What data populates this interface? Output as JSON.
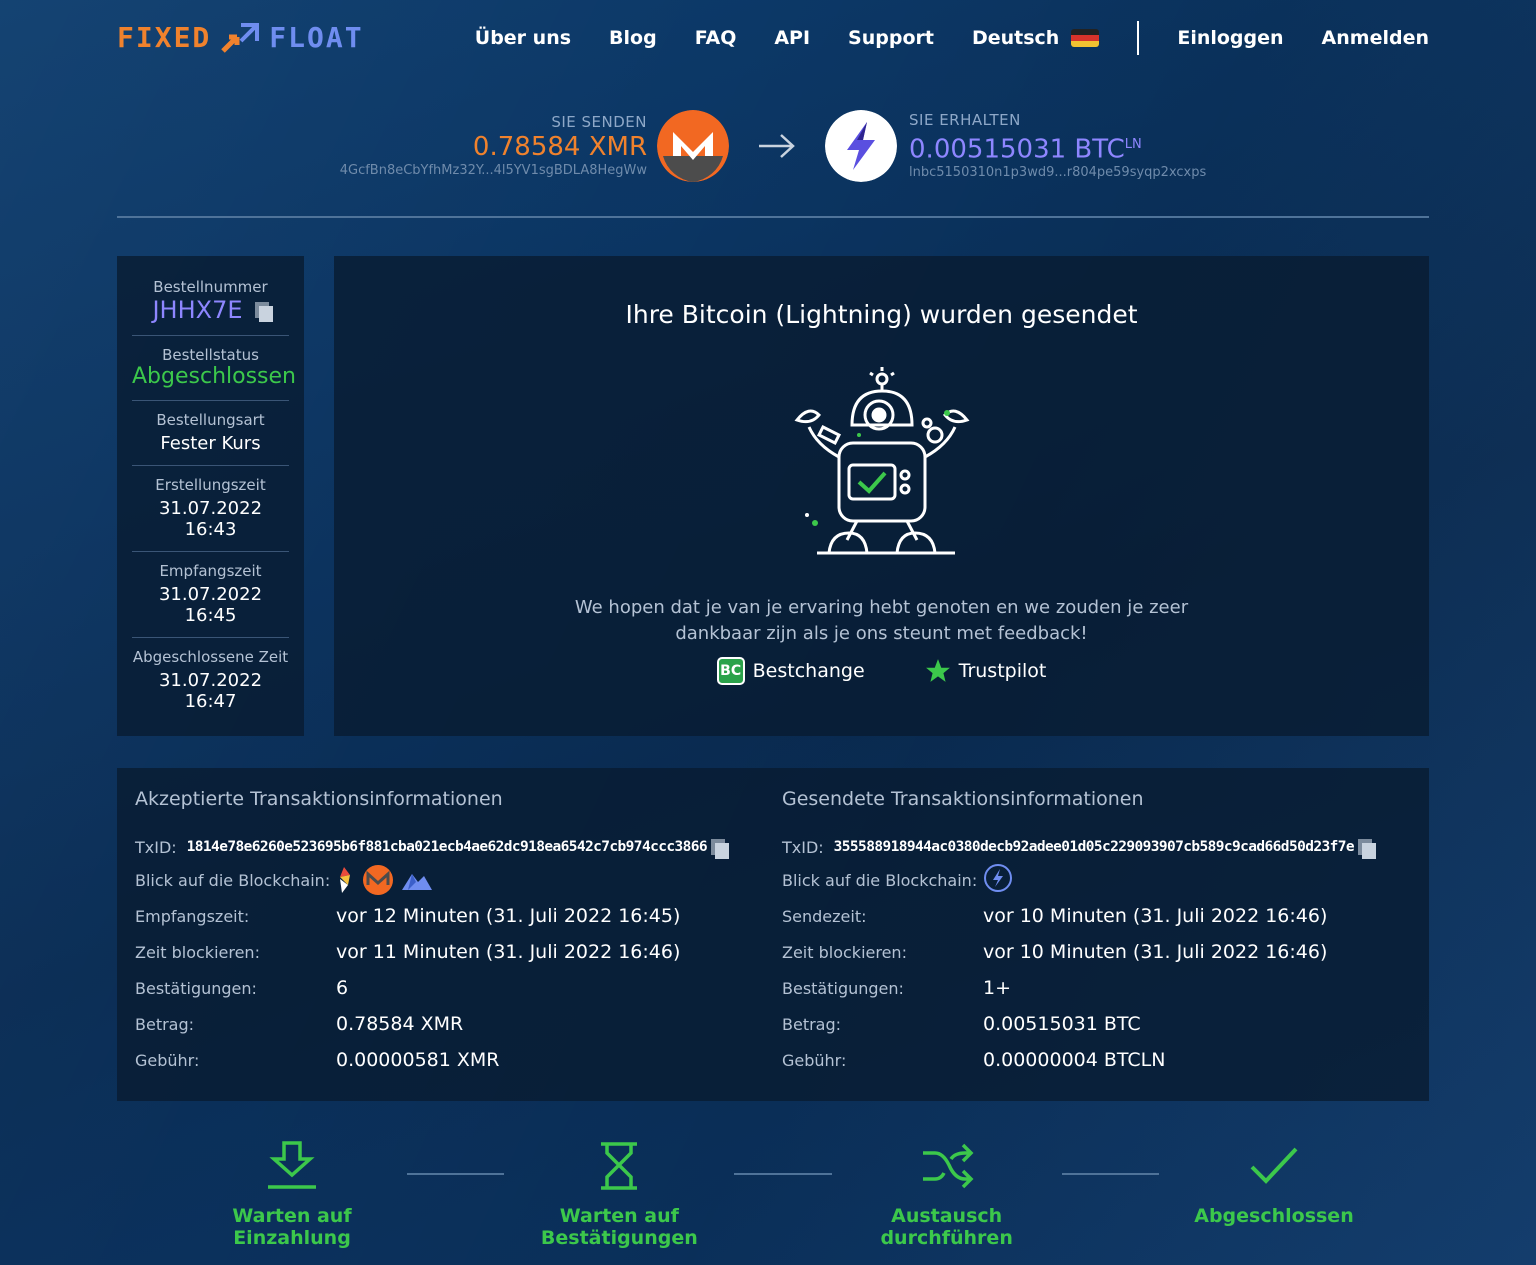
{
  "brand": {
    "part1": "FIXED",
    "part2": "FLOAT"
  },
  "nav": {
    "items": [
      "Über uns",
      "Blog",
      "FAQ",
      "API",
      "Support"
    ],
    "language": "Deutsch",
    "login": "Einloggen",
    "register": "Anmelden"
  },
  "exchange": {
    "send_label": "SIE SENDEN",
    "send_amount": "0.78584 XMR",
    "send_address": "4GcfBn8eCbYfhMz32Y...4l5YV1sgBDLA8HegWw",
    "receive_label": "SIE ERHALTEN",
    "receive_amount": "0.00515031 BTC",
    "receive_suffix": "LN",
    "receive_address": "lnbc5150310n1p3wd9...r804pe59syqp2xcxps"
  },
  "order": {
    "number_label": "Bestellnummer",
    "number": "JHHX7E",
    "status_label": "Bestellstatus",
    "status": "Abgeschlossen",
    "type_label": "Bestellungsart",
    "type": "Fester Kurs",
    "created_label": "Erstellungszeit",
    "created": "31.07.2022 16:43",
    "received_label": "Empfangszeit",
    "received": "31.07.2022 16:45",
    "completed_label": "Abgeschlossene Zeit",
    "completed": "31.07.2022 16:47"
  },
  "panel": {
    "title": "Ihre Bitcoin (Lightning) wurden gesendet",
    "message_line1": "We hopen dat je van je ervaring hebt genoten en we zouden je zeer",
    "message_line2": "dankbaar zijn als je ons steunt met feedback!",
    "bestchange": "Bestchange",
    "bestchange_icon_text": "BC",
    "trustpilot": "Trustpilot"
  },
  "accepted": {
    "title": "Akzeptierte Transaktionsinformationen",
    "txid_label": "TxID:",
    "txid": "1814e78e6260e523695b6f881cba021ecb4ae62dc918ea6542c7cb974ccc3866",
    "explorer_label": "Blick auf die Blockchain:",
    "time_label": "Empfangszeit:",
    "time": "vor 12 Minuten (31. Juli 2022 16:45)",
    "block_label": "Zeit blockieren:",
    "block": "vor 11 Minuten (31. Juli 2022 16:46)",
    "conf_label": "Bestätigungen:",
    "conf": "6",
    "amount_label": "Betrag:",
    "amount": "0.78584 XMR",
    "fee_label": "Gebühr:",
    "fee": "0.00000581 XMR"
  },
  "sent": {
    "title": "Gesendete Transaktionsinformationen",
    "txid_label": "TxID:",
    "txid": "355588918944ac0380decb92adee01d05c229093907cb589c9cad66d50d23f7e",
    "explorer_label": "Blick auf die Blockchain:",
    "time_label": "Sendezeit:",
    "time": "vor 10 Minuten (31. Juli 2022 16:46)",
    "block_label": "Zeit blockieren:",
    "block": "vor 10 Minuten (31. Juli 2022 16:46)",
    "conf_label": "Bestätigungen:",
    "conf": "1+",
    "amount_label": "Betrag:",
    "amount": "0.00515031 BTC",
    "fee_label": "Gebühr:",
    "fee": "0.00000004 BTCLN"
  },
  "steps": [
    "Warten auf Einzahlung",
    "Warten auf Bestätigungen",
    "Austausch durchführen",
    "Abgeschlossen"
  ],
  "colors": {
    "accent_orange": "#f0822d",
    "accent_purple": "#8e86ff",
    "success_green": "#3cc84b"
  }
}
